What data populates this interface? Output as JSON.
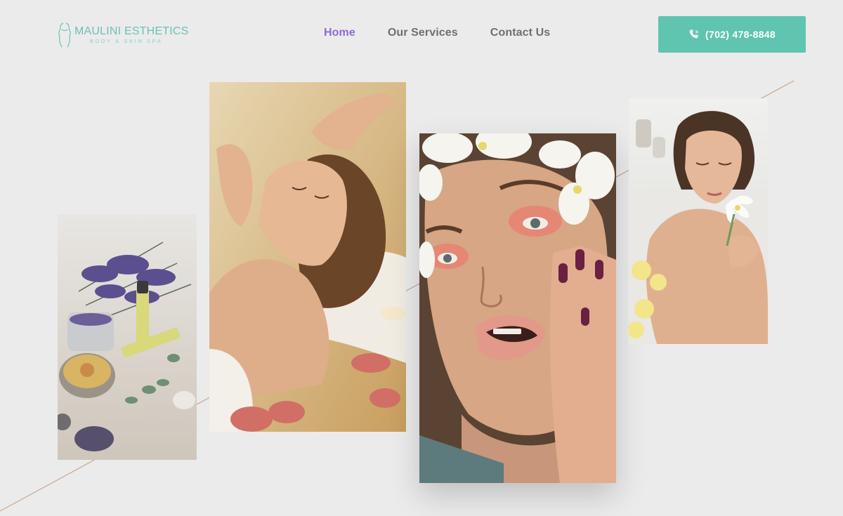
{
  "brand": {
    "name": "MAULINI ESTHETICS",
    "tagline": "BODY & SKIN SPA",
    "color": "#6cc1b8"
  },
  "nav": {
    "items": [
      {
        "label": "Home",
        "active": true
      },
      {
        "label": "Our Services",
        "active": false
      },
      {
        "label": "Contact Us",
        "active": false
      }
    ],
    "active_color": "#8e6ad8"
  },
  "cta": {
    "phone": "(702) 478-8848",
    "icon": "phone-icon",
    "color": "#5fc4b0"
  },
  "gallery": {
    "images": [
      {
        "name": "aromatherapy-photo",
        "subject": "lavender, essential oils and stones"
      },
      {
        "name": "facial-massage-photo",
        "subject": "woman receiving facial massage"
      },
      {
        "name": "makeup-beauty-photo",
        "subject": "woman with orchids and pink makeup"
      },
      {
        "name": "bath-relaxation-photo",
        "subject": "woman smelling a white flower"
      }
    ]
  }
}
